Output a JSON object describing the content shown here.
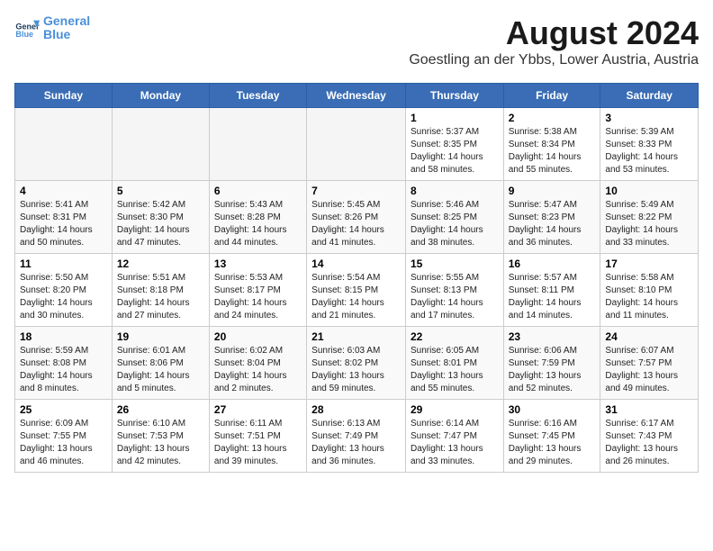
{
  "header": {
    "logo_line1": "General",
    "logo_line2": "Blue",
    "month_title": "August 2024",
    "subtitle": "Goestling an der Ybbs, Lower Austria, Austria"
  },
  "weekdays": [
    "Sunday",
    "Monday",
    "Tuesday",
    "Wednesday",
    "Thursday",
    "Friday",
    "Saturday"
  ],
  "weeks": [
    [
      {
        "day": "",
        "info": ""
      },
      {
        "day": "",
        "info": ""
      },
      {
        "day": "",
        "info": ""
      },
      {
        "day": "",
        "info": ""
      },
      {
        "day": "1",
        "info": "Sunrise: 5:37 AM\nSunset: 8:35 PM\nDaylight: 14 hours\nand 58 minutes."
      },
      {
        "day": "2",
        "info": "Sunrise: 5:38 AM\nSunset: 8:34 PM\nDaylight: 14 hours\nand 55 minutes."
      },
      {
        "day": "3",
        "info": "Sunrise: 5:39 AM\nSunset: 8:33 PM\nDaylight: 14 hours\nand 53 minutes."
      }
    ],
    [
      {
        "day": "4",
        "info": "Sunrise: 5:41 AM\nSunset: 8:31 PM\nDaylight: 14 hours\nand 50 minutes."
      },
      {
        "day": "5",
        "info": "Sunrise: 5:42 AM\nSunset: 8:30 PM\nDaylight: 14 hours\nand 47 minutes."
      },
      {
        "day": "6",
        "info": "Sunrise: 5:43 AM\nSunset: 8:28 PM\nDaylight: 14 hours\nand 44 minutes."
      },
      {
        "day": "7",
        "info": "Sunrise: 5:45 AM\nSunset: 8:26 PM\nDaylight: 14 hours\nand 41 minutes."
      },
      {
        "day": "8",
        "info": "Sunrise: 5:46 AM\nSunset: 8:25 PM\nDaylight: 14 hours\nand 38 minutes."
      },
      {
        "day": "9",
        "info": "Sunrise: 5:47 AM\nSunset: 8:23 PM\nDaylight: 14 hours\nand 36 minutes."
      },
      {
        "day": "10",
        "info": "Sunrise: 5:49 AM\nSunset: 8:22 PM\nDaylight: 14 hours\nand 33 minutes."
      }
    ],
    [
      {
        "day": "11",
        "info": "Sunrise: 5:50 AM\nSunset: 8:20 PM\nDaylight: 14 hours\nand 30 minutes."
      },
      {
        "day": "12",
        "info": "Sunrise: 5:51 AM\nSunset: 8:18 PM\nDaylight: 14 hours\nand 27 minutes."
      },
      {
        "day": "13",
        "info": "Sunrise: 5:53 AM\nSunset: 8:17 PM\nDaylight: 14 hours\nand 24 minutes."
      },
      {
        "day": "14",
        "info": "Sunrise: 5:54 AM\nSunset: 8:15 PM\nDaylight: 14 hours\nand 21 minutes."
      },
      {
        "day": "15",
        "info": "Sunrise: 5:55 AM\nSunset: 8:13 PM\nDaylight: 14 hours\nand 17 minutes."
      },
      {
        "day": "16",
        "info": "Sunrise: 5:57 AM\nSunset: 8:11 PM\nDaylight: 14 hours\nand 14 minutes."
      },
      {
        "day": "17",
        "info": "Sunrise: 5:58 AM\nSunset: 8:10 PM\nDaylight: 14 hours\nand 11 minutes."
      }
    ],
    [
      {
        "day": "18",
        "info": "Sunrise: 5:59 AM\nSunset: 8:08 PM\nDaylight: 14 hours\nand 8 minutes."
      },
      {
        "day": "19",
        "info": "Sunrise: 6:01 AM\nSunset: 8:06 PM\nDaylight: 14 hours\nand 5 minutes."
      },
      {
        "day": "20",
        "info": "Sunrise: 6:02 AM\nSunset: 8:04 PM\nDaylight: 14 hours\nand 2 minutes."
      },
      {
        "day": "21",
        "info": "Sunrise: 6:03 AM\nSunset: 8:02 PM\nDaylight: 13 hours\nand 59 minutes."
      },
      {
        "day": "22",
        "info": "Sunrise: 6:05 AM\nSunset: 8:01 PM\nDaylight: 13 hours\nand 55 minutes."
      },
      {
        "day": "23",
        "info": "Sunrise: 6:06 AM\nSunset: 7:59 PM\nDaylight: 13 hours\nand 52 minutes."
      },
      {
        "day": "24",
        "info": "Sunrise: 6:07 AM\nSunset: 7:57 PM\nDaylight: 13 hours\nand 49 minutes."
      }
    ],
    [
      {
        "day": "25",
        "info": "Sunrise: 6:09 AM\nSunset: 7:55 PM\nDaylight: 13 hours\nand 46 minutes."
      },
      {
        "day": "26",
        "info": "Sunrise: 6:10 AM\nSunset: 7:53 PM\nDaylight: 13 hours\nand 42 minutes."
      },
      {
        "day": "27",
        "info": "Sunrise: 6:11 AM\nSunset: 7:51 PM\nDaylight: 13 hours\nand 39 minutes."
      },
      {
        "day": "28",
        "info": "Sunrise: 6:13 AM\nSunset: 7:49 PM\nDaylight: 13 hours\nand 36 minutes."
      },
      {
        "day": "29",
        "info": "Sunrise: 6:14 AM\nSunset: 7:47 PM\nDaylight: 13 hours\nand 33 minutes."
      },
      {
        "day": "30",
        "info": "Sunrise: 6:16 AM\nSunset: 7:45 PM\nDaylight: 13 hours\nand 29 minutes."
      },
      {
        "day": "31",
        "info": "Sunrise: 6:17 AM\nSunset: 7:43 PM\nDaylight: 13 hours\nand 26 minutes."
      }
    ]
  ]
}
